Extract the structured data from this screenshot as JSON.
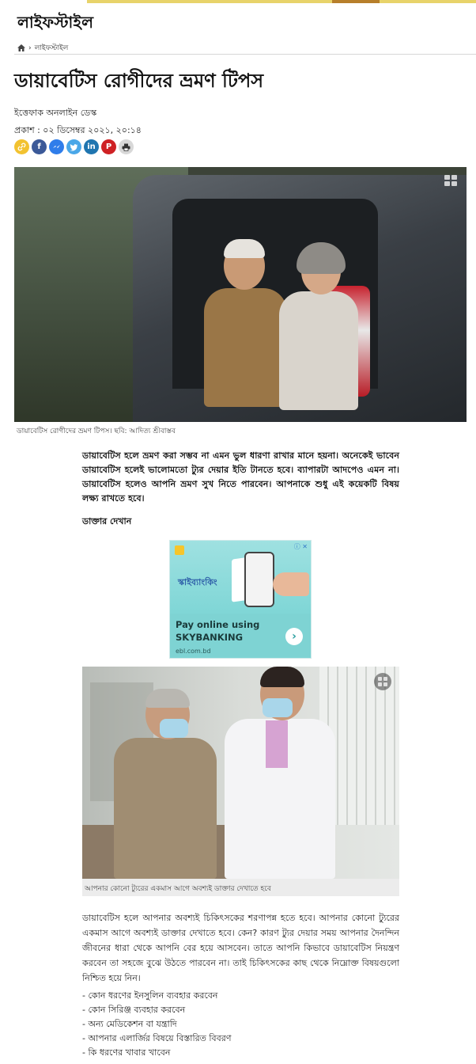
{
  "section": {
    "title": "লাইফস্টাইল"
  },
  "breadcrumb": {
    "home_icon": "home-icon",
    "separator": "›",
    "current": "লাইফস্টাইল"
  },
  "article": {
    "headline": "ডায়াবেটিস রোগীদের ভ্রমণ টিপস",
    "author": "ইত্তেফাক অনলাইন ডেস্ক",
    "published": "প্রকাশ : ০২ ডিসেম্বর ২০২১, ২০:১৪",
    "share_icons": [
      "link-icon",
      "facebook-icon",
      "messenger-icon",
      "twitter-icon",
      "linkedin-icon",
      "pinterest-icon",
      "print-icon"
    ],
    "hero_caption": "ডায়াবেটিস রোগীদের ভ্রমণ টিপস। ছবি: আদিত্য শ্রীবাস্তব",
    "lead": "ডায়াবেটিস হলে ভ্রমণ করা সম্ভব না এমন ভুল ধারণা রাখার মানে হয়না। অনেকেই ভাবেন ডায়াবেটিস হলেই ভালোমতো ট্যুর দেয়ার ইতি টানতে হবে। ব্যাপারটা আদপেও এমন না। ডায়াবেটিস হলেও আপনি ভ্রমণ সুখ নিতে পারবেন। আপনাকে শুধু এই কয়েকটি বিষয় লক্ষ্য রাখতে হবে।",
    "subhead": "ডাক্তার দেখান",
    "photo2_caption": "আপনার কোনো ট্যুরের একমাস আগে অবশ্যই ডাক্তার দেখাতে হবে",
    "paragraph": "ডায়াবেটিস হলে আপনার অবশ্যই চিকিৎসকের শরণাপন্ন হতে হবে। আপনার কোনো ট্যুরের একমাস আগে অবশ্যই ডাক্তার দেখাতে হবে। কেন? কারণ ট্যুর দেয়ার সময় আপনার দৈনন্দিন জীবনের ধারা থেকে আপনি বের হয়ে আসবেন। তাতে আপনি কিভাবে ডায়াবেটিস নিয়ন্ত্রণ করবেন তা সহজে বুঝে উঠতে পারবেন না। তাই চিকিৎসকের কাছ থেকে নিম্নোক্ত বিষয়গুলো নিশ্চিত হয়ে নিন।",
    "list": [
      "- কোন ধরণের ইনসুলিন ব্যবহার করবেন",
      "- কোন সিরিঞ্জ ব্যবহার করবেন",
      "- অন্য মেডিকেশন বা যন্ত্রাদি",
      "- আপনার এলার্জির বিষয়ে বিস্তারিত বিবরণ",
      "- কি ধরণের খাবার খাবেন"
    ]
  },
  "ad": {
    "brand_text": "স্কাইব্যাংকিং",
    "headline": "Pay online using SKYBANKING",
    "domain": "ebl.com.bd",
    "adchoices": "ⓘ ✕",
    "cta": "›"
  }
}
